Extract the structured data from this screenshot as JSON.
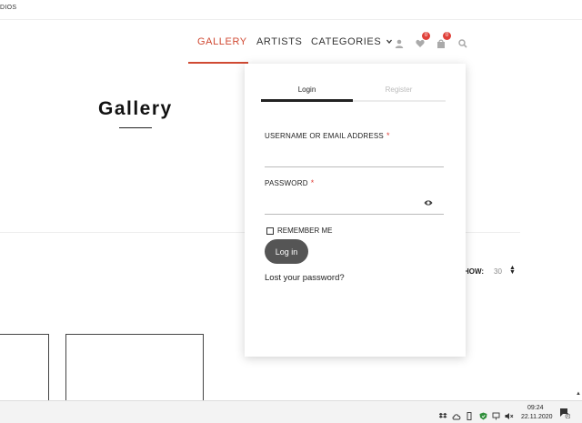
{
  "topbar": {
    "brand": "DIOS"
  },
  "nav": {
    "gallery": "GALLERY",
    "artists": "ARTISTS",
    "categories": "CATEGORIES",
    "wishlist_count": "0",
    "cart_count": "0"
  },
  "page": {
    "title": "Gallery"
  },
  "toolbar": {
    "show_label": "HOW:",
    "show_value": "30"
  },
  "login_dropdown": {
    "tab_login": "Login",
    "tab_register": "Register",
    "username_label": "USERNAME OR EMAIL ADDRESS",
    "password_label": "PASSWORD",
    "required_mark": "*",
    "username_value": "",
    "password_value": "",
    "remember_label": "REMEMBER ME",
    "login_button": "Log in",
    "lost_password": "Lost your password?"
  },
  "taskbar": {
    "time": "09:24",
    "date": "22.11.2020",
    "notification_count": "1"
  },
  "colors": {
    "accent": "#d04a33",
    "badge": "#e0413a",
    "button": "#555555"
  }
}
